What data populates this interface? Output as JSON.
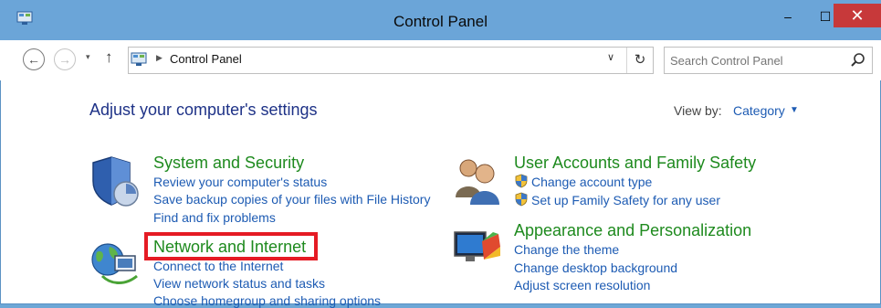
{
  "window": {
    "title": "Control Panel",
    "controls": {
      "minimize": "–",
      "maximize": "☐",
      "close": "✕"
    }
  },
  "toolbar": {
    "back_icon": "←",
    "forward_icon": "→",
    "recent_icon": "▾",
    "up_icon": "↑",
    "breadcrumb": "Control Panel",
    "address_dropdown_icon": "∨",
    "refresh_icon": "↻",
    "search_placeholder": "Search Control Panel"
  },
  "main": {
    "heading": "Adjust your computer's settings",
    "view_by_label": "View by:",
    "view_by_value": "Category",
    "categories": [
      {
        "title": "System and Security",
        "icon": "shield-icon",
        "links": [
          "Review your computer's status",
          "Save backup copies of your files with File History",
          "Find and fix problems"
        ]
      },
      {
        "title": "Network and Internet",
        "icon": "globe-network-icon",
        "links": [
          "Connect to the Internet",
          "View network status and tasks",
          "Choose homegroup and sharing options"
        ]
      },
      {
        "title": "User Accounts and Family Safety",
        "icon": "users-icon",
        "links": [
          "Change account type",
          "Set up Family Safety for any user"
        ]
      },
      {
        "title": "Appearance and Personalization",
        "icon": "monitor-palette-icon",
        "links": [
          "Change the theme",
          "Change desktop background",
          "Adjust screen resolution"
        ]
      }
    ]
  },
  "colors": {
    "titlebar": "#6ba5d8",
    "close": "#c7393a",
    "category_title": "#1e8a1e",
    "link": "#1d5bb3",
    "highlight": "#e51b24"
  }
}
